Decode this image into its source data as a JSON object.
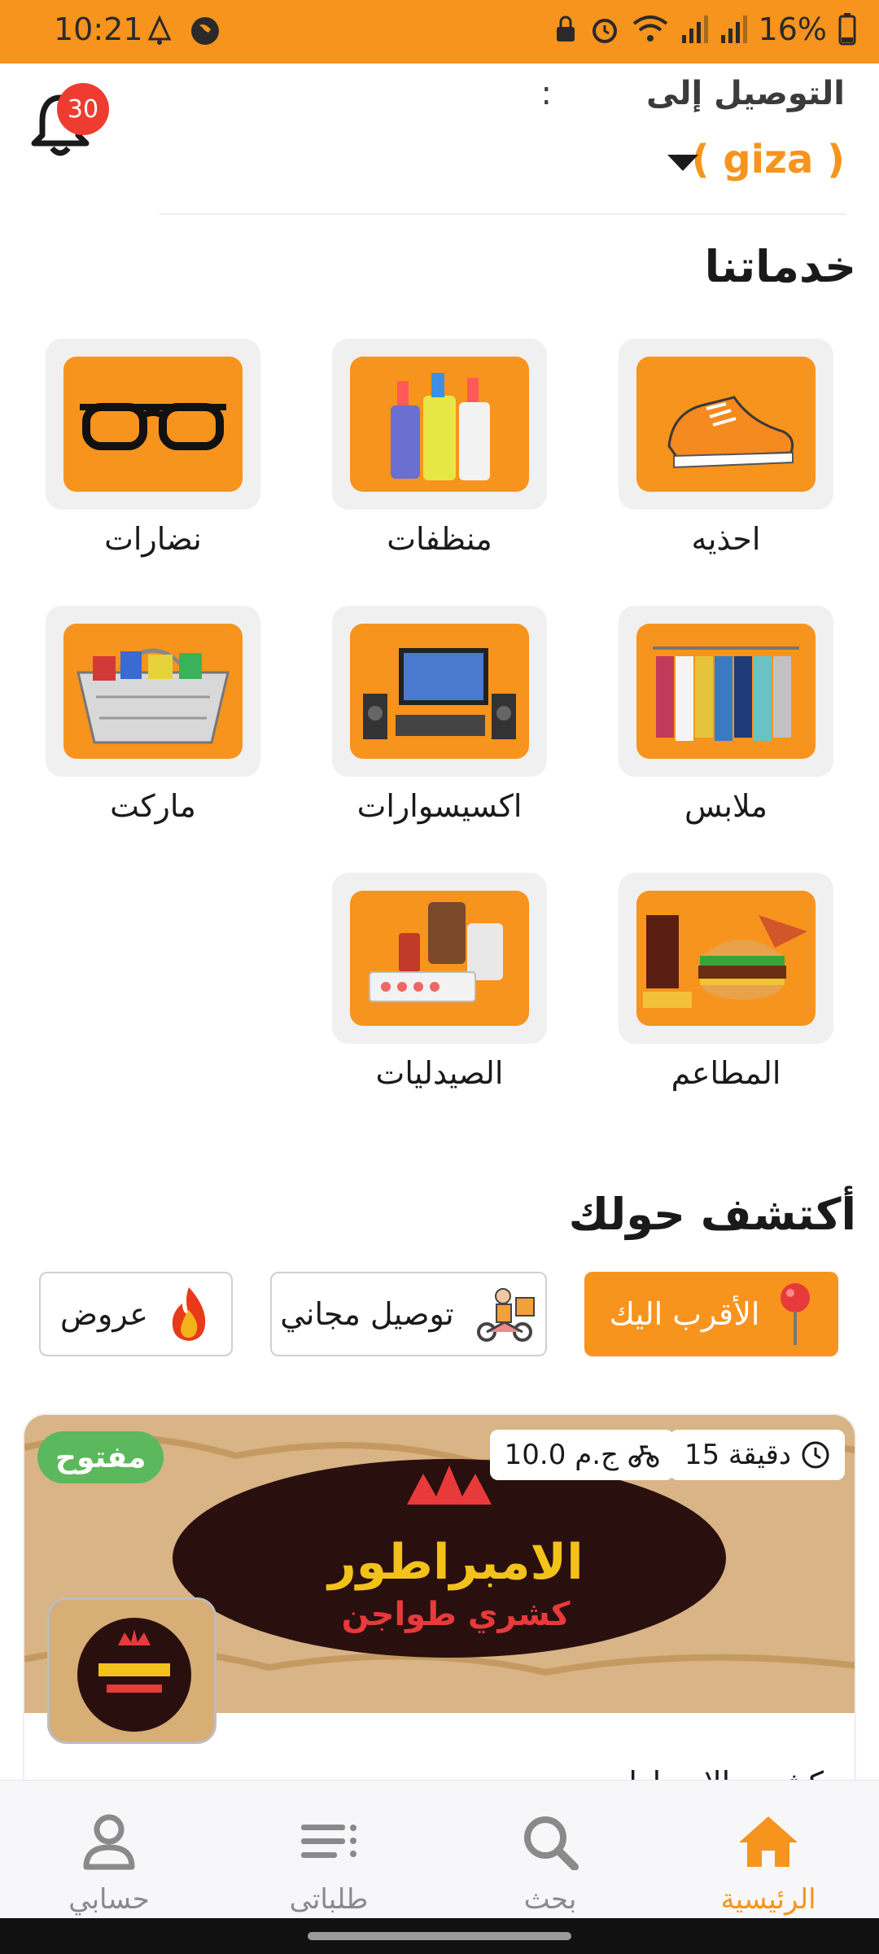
{
  "status_bar": {
    "time": "10:21",
    "battery_percent": "16%"
  },
  "header": {
    "deliver_to_label": "التوصيل إلى",
    "deliver_to_colon": ":",
    "location": "( giza )",
    "notification_count": "30"
  },
  "services": {
    "title": "خدماتنا",
    "items": [
      {
        "label": "احذيه",
        "icon": "shoe-image"
      },
      {
        "label": "منظفات",
        "icon": "cleaners-image"
      },
      {
        "label": "نضارات",
        "icon": "glasses-image"
      },
      {
        "label": "ملابس",
        "icon": "clothes-image"
      },
      {
        "label": "اكسيسوارات",
        "icon": "electronics-image"
      },
      {
        "label": "ماركت",
        "icon": "market-basket-image"
      },
      {
        "label": "المطاعم",
        "icon": "fastfood-image"
      },
      {
        "label": "الصيدليات",
        "icon": "pharmacy-image"
      }
    ]
  },
  "discover": {
    "title": "أكتشف حولك",
    "chips": [
      {
        "label": "الأقرب اليك",
        "icon": "location-pin-icon",
        "active": true
      },
      {
        "label": "توصيل مجاني",
        "icon": "delivery-scooter-icon",
        "active": false
      },
      {
        "label": "عروض",
        "icon": "fire-icon",
        "active": false
      }
    ]
  },
  "restaurant": {
    "status": "مفتوح",
    "delivery_time": "15 دقيقة",
    "delivery_fee": "10.0 ج.م",
    "banner_title": "الامبراطور",
    "banner_subtitle": "كشري طواجن",
    "name_partial": "كشري الامبراطور"
  },
  "bottom_nav": {
    "items": [
      {
        "label": "الرئيسية",
        "icon": "home-icon",
        "active": true
      },
      {
        "label": "بحث",
        "icon": "search-icon",
        "active": false
      },
      {
        "label": "طلباتى",
        "icon": "orders-list-icon",
        "active": false
      },
      {
        "label": "حسابي",
        "icon": "profile-icon",
        "active": false
      }
    ]
  },
  "colors": {
    "brand": "#f7941d",
    "open_green": "#5cb85c",
    "badge_red": "#ee3c31"
  }
}
